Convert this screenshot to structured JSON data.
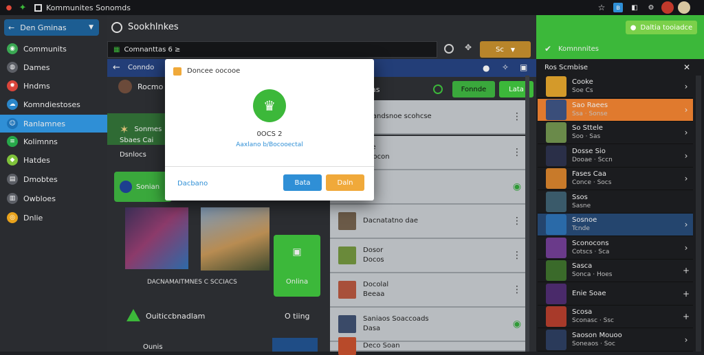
{
  "window": {
    "title": "Kommunites Sonomds"
  },
  "titlebar_icons": [
    "star-icon",
    "bluetooth-icon",
    "tab-icon",
    "settings-icon"
  ],
  "sidebar": {
    "dropdown_label": "Den Gminas",
    "items": [
      {
        "label": "Communits",
        "icon": "globe-icon",
        "color": "#3aa853"
      },
      {
        "label": "Dames",
        "icon": "controller-icon",
        "color": "#5c5f66"
      },
      {
        "label": "Hndms",
        "icon": "fire-icon",
        "color": "#d9453b"
      },
      {
        "label": "Komndiestoses",
        "icon": "cloud-icon",
        "color": "#2b86c9"
      },
      {
        "label": "Ranlamnes",
        "icon": "user-icon",
        "color": "#1d73b8"
      },
      {
        "label": "Kolimnns",
        "icon": "bars-icon",
        "color": "#27a84a"
      },
      {
        "label": "Hatdes",
        "icon": "tag-icon",
        "color": "#7fc23a"
      },
      {
        "label": "Dmobtes",
        "icon": "page-icon",
        "color": "#5c5f66"
      },
      {
        "label": "Owbloes",
        "icon": "doc-icon",
        "color": "#5c5f66"
      },
      {
        "label": "Dnlie",
        "icon": "coin-icon",
        "color": "#e8a21c"
      }
    ]
  },
  "header": {
    "title": "Sookhlnkes",
    "search_value": "Comnanttas 6 ≥",
    "action_label": "Sc"
  },
  "community_bar": {
    "back_label": "Conndo"
  },
  "feature": {
    "profile_name": "Rocmo",
    "tile_label": "Sonmes",
    "rows": [
      "Sbaes Cai",
      "Dsnlocs"
    ],
    "green_card_label": "Sonian",
    "media_caption": "DACNAMAITMNES C SCCIACS",
    "online_label": "Onlina",
    "footer_label": "Ouiticcbnadlam",
    "footer_right": "O tiing",
    "bottom_label": "Ounis"
  },
  "list_panel": {
    "header": "as",
    "tab_label": "Fonnde",
    "tab2_label": "Lata",
    "rows": [
      {
        "title": "Deandsnoe scohcse",
        "sub": ""
      },
      {
        "title": "Soe",
        "sub": "o socon"
      },
      {
        "title": "Ol",
        "sub": ""
      },
      {
        "title": "Dacnatatno dae",
        "sub": ""
      },
      {
        "title": "Dosor",
        "sub": "Docos"
      },
      {
        "title": "Docolal",
        "sub": "Beeaa"
      },
      {
        "title": "Saniaos Soaccoads",
        "sub": "Dasa"
      },
      {
        "title": "Deco Soan",
        "sub": ""
      }
    ]
  },
  "dialog": {
    "title": "Doncee oocooe",
    "code": "0OCS 2",
    "link": "Aaxlano b/Bocooectal",
    "left_label": "Dacbano",
    "primary_label": "Bata",
    "secondary_label": "Daln"
  },
  "right_panel": {
    "top_button": "Daltia tooiadce",
    "header": "Komnnnites",
    "subheader": "Ros Scmbise",
    "rows": [
      {
        "title": "Cooke",
        "sub": "Soe Cs"
      },
      {
        "title": "Sao Raees",
        "sub": "Ssa · Sonse"
      },
      {
        "title": "So Sttele",
        "sub": "Soo · Sas"
      },
      {
        "title": "Dosse Sio",
        "sub": "Dooae · Sccn"
      },
      {
        "title": "Fases Caa",
        "sub": "Conce · Socs"
      },
      {
        "title": "Ssos",
        "sub": "Sasne"
      },
      {
        "title": "Sosnoe",
        "sub": "Tcnde"
      },
      {
        "title": "Sconocons",
        "sub": "Cotscs · Sca"
      },
      {
        "title": "Sasca",
        "sub": "Sonca · Hoes"
      },
      {
        "title": "Enie Soae",
        "sub": ""
      },
      {
        "title": "Scosa",
        "sub": "Sconasc · Ssc"
      },
      {
        "title": "Saoson Mouoo",
        "sub": "Soneaos · Soc"
      }
    ]
  },
  "colors": {
    "accent_green": "#3cb83a",
    "accent_blue": "#2f8fd6",
    "accent_orange": "#e6812a",
    "dialog_primary": "#2f8fd6",
    "dialog_secondary": "#f0a93a"
  }
}
